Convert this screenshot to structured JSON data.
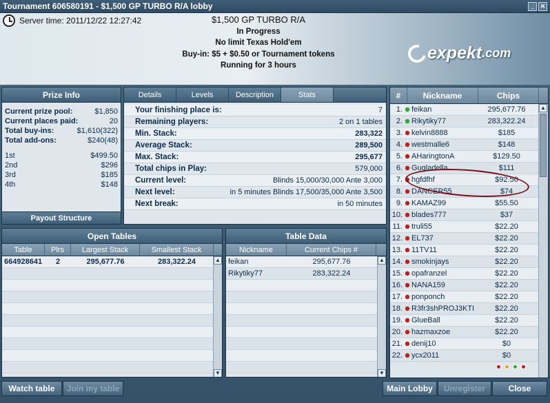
{
  "window": {
    "title": "Tournament 606580191 - $1,500 GP TURBO R/A lobby",
    "minimize_label": "_",
    "close_label": "✕"
  },
  "header": {
    "server_time_label": "Server time: 2011/12/22 12:27:42",
    "tournament_name": "$1,500 GP TURBO R/A",
    "status": "In Progress",
    "game": "No limit Texas Hold'em",
    "buyin": "Buy-in: $5 + $0.50 or Tournament tokens",
    "running": "Running for 3 hours",
    "logo_text": "expekt",
    "logo_suffix": ".com"
  },
  "prize_info": {
    "title": "Prize Info",
    "rows": [
      {
        "label": "Current prize pool:",
        "value": "$1,850"
      },
      {
        "label": "Current places paid:",
        "value": "20"
      },
      {
        "label": "Total buy-ins:",
        "value": "$1,610(322)"
      },
      {
        "label": "Total add-ons:",
        "value": "$240(48)"
      }
    ],
    "places": [
      {
        "label": "1st",
        "value": "$499.50"
      },
      {
        "label": "2nd",
        "value": "$296"
      },
      {
        "label": "3rd",
        "value": "$185"
      },
      {
        "label": "4th",
        "value": "$148"
      }
    ],
    "footer": "Payout Structure"
  },
  "stats": {
    "tabs": [
      "Details",
      "Levels",
      "Description",
      "Stats"
    ],
    "active_tab": "Stats",
    "rows": [
      {
        "label": "Your finishing place is:",
        "value": "7"
      },
      {
        "label": "Remaining players:",
        "value": "2 on 1 tables"
      },
      {
        "label": "Min. Stack:",
        "value": "283,322"
      },
      {
        "label": "Average Stack:",
        "value": "289,500"
      },
      {
        "label": "Max. Stack:",
        "value": "295,677"
      },
      {
        "label": "Total chips in Play:",
        "value": "579,000"
      },
      {
        "label": "Current level:",
        "value": "Blinds 15,000/30,000 Ante 3,000"
      },
      {
        "label": "Next level:",
        "value": "in 5 minutes Blinds 17,500/35,000 Ante 3,500"
      },
      {
        "label": "Next break:",
        "value": "in 50 minutes"
      }
    ]
  },
  "open_tables": {
    "title": "Open Tables",
    "columns": [
      "Table",
      "Plrs",
      "Largest Stack",
      "Smallest Stack"
    ],
    "rows": [
      {
        "table": "664928641",
        "plrs": "2",
        "largest": "295,677.76",
        "smallest": "283,322.24"
      }
    ]
  },
  "table_data": {
    "title": "Table Data",
    "columns": [
      "Nickname",
      "Current Chips #"
    ],
    "rows": [
      {
        "nick": "feikan",
        "chips": "295,677.76"
      },
      {
        "nick": "Rikytiky77",
        "chips": "283,322.24"
      }
    ]
  },
  "players": {
    "columns": [
      "#",
      "Nickname",
      "Chips"
    ],
    "rows": [
      {
        "n": "1.",
        "nick": "feikan",
        "chips": "295,677.76",
        "status": "green"
      },
      {
        "n": "2.",
        "nick": "Rikytiky77",
        "chips": "283,322.24",
        "status": "green"
      },
      {
        "n": "3.",
        "nick": "kelvin8888",
        "chips": "$185",
        "status": "red"
      },
      {
        "n": "4.",
        "nick": "westmalle6",
        "chips": "$148",
        "status": "red"
      },
      {
        "n": "5.",
        "nick": "AHaringtonA",
        "chips": "$129.50",
        "status": "red"
      },
      {
        "n": "6.",
        "nick": "Gugladella",
        "chips": "$111",
        "status": "red"
      },
      {
        "n": "7.",
        "nick": "hgfdfhf",
        "chips": "$92.50",
        "status": "red"
      },
      {
        "n": "8.",
        "nick": "DANCER55",
        "chips": "$74",
        "status": "red"
      },
      {
        "n": "9.",
        "nick": "KAMAZ99",
        "chips": "$55.50",
        "status": "red"
      },
      {
        "n": "10.",
        "nick": "blades777",
        "chips": "$37",
        "status": "red"
      },
      {
        "n": "11.",
        "nick": "truli55",
        "chips": "$22.20",
        "status": "red"
      },
      {
        "n": "12.",
        "nick": "EL737",
        "chips": "$22.20",
        "status": "red"
      },
      {
        "n": "13.",
        "nick": "11TV11",
        "chips": "$22.20",
        "status": "red"
      },
      {
        "n": "14.",
        "nick": "smokinjays",
        "chips": "$22.20",
        "status": "red"
      },
      {
        "n": "15.",
        "nick": "opafranzel",
        "chips": "$22.20",
        "status": "red"
      },
      {
        "n": "16.",
        "nick": "NANA159",
        "chips": "$22.20",
        "status": "red"
      },
      {
        "n": "17.",
        "nick": "ponponch",
        "chips": "$22.20",
        "status": "red"
      },
      {
        "n": "18.",
        "nick": "R3fr3shPROJ3KTI",
        "chips": "$22.20",
        "status": "red"
      },
      {
        "n": "19.",
        "nick": "GlueBall",
        "chips": "$22.20",
        "status": "red"
      },
      {
        "n": "20.",
        "nick": "hazmaxzoe",
        "chips": "$22.20",
        "status": "red"
      },
      {
        "n": "21.",
        "nick": "denij10",
        "chips": "$0",
        "status": "red"
      },
      {
        "n": "22.",
        "nick": "ycx2011",
        "chips": "$0",
        "status": "red"
      }
    ]
  },
  "legend_colors": [
    "#c21d1d",
    "#e8a020",
    "#2fa82f",
    "#c21d1d"
  ],
  "buttons": {
    "watch_table": "Watch table",
    "join_my_table": "Join my table",
    "main_lobby": "Main Lobby",
    "unregister": "Unregister",
    "close": "Close"
  }
}
